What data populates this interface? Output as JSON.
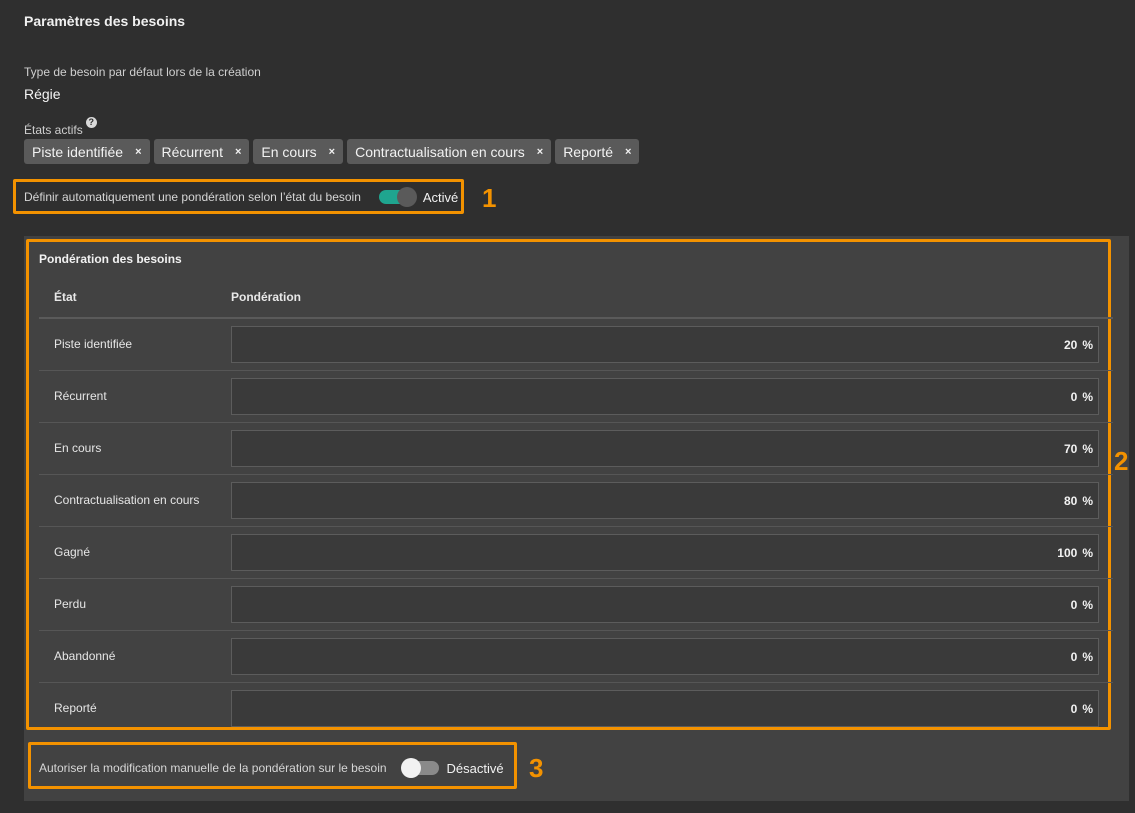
{
  "page": {
    "title": "Paramètres des besoins"
  },
  "default_type": {
    "label": "Type de besoin par défaut lors de la création",
    "value": "Régie"
  },
  "active_states": {
    "label": "États actifs",
    "help_icon": "?",
    "chips": [
      {
        "label": "Piste identifiée",
        "remove": "×"
      },
      {
        "label": "Récurrent",
        "remove": "×"
      },
      {
        "label": "En cours",
        "remove": "×"
      },
      {
        "label": "Contractualisation en cours",
        "remove": "×"
      },
      {
        "label": "Reporté",
        "remove": "×"
      }
    ]
  },
  "auto_weighting": {
    "label": "Définir automatiquement une pondération selon l’état du besoin",
    "state": "Activé",
    "enabled": true,
    "annotation": "1"
  },
  "weighting_table": {
    "title": "Pondération des besoins",
    "columns": {
      "state": "État",
      "weight": "Pondération"
    },
    "unit": "%",
    "annotation": "2",
    "rows": [
      {
        "state": "Piste identifiée",
        "value": "20"
      },
      {
        "state": "Récurrent",
        "value": "0"
      },
      {
        "state": "En cours",
        "value": "70"
      },
      {
        "state": "Contractualisation en cours",
        "value": "80"
      },
      {
        "state": "Gagné",
        "value": "100"
      },
      {
        "state": "Perdu",
        "value": "0"
      },
      {
        "state": "Abandonné",
        "value": "0"
      },
      {
        "state": "Reporté",
        "value": "0"
      }
    ]
  },
  "manual_override": {
    "label": "Autoriser la modification manuelle de la pondération sur le besoin",
    "state": "Désactivé",
    "enabled": false,
    "annotation": "3"
  },
  "colors": {
    "accent": "#f39200",
    "toggle_on": "#1fa58f",
    "background": "#2f2f2f",
    "panel": "#424242"
  }
}
